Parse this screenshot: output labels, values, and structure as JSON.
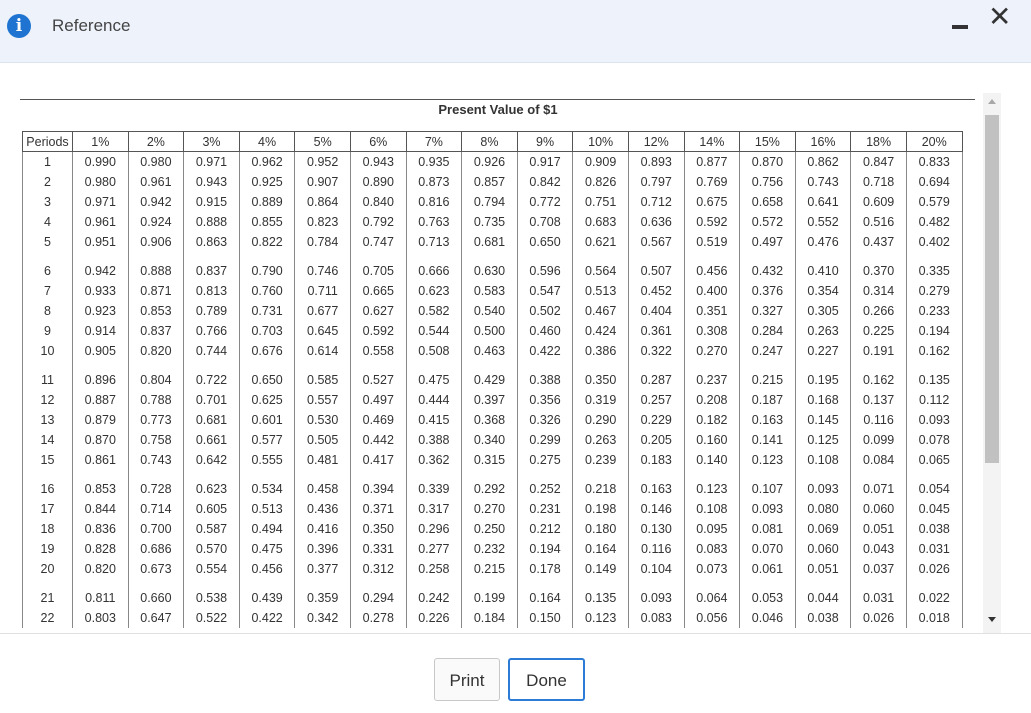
{
  "header": {
    "title": "Reference",
    "info_icon": "i",
    "minimize_icon": "minimize-icon",
    "close_icon": "✕"
  },
  "table": {
    "title": "Present Value of $1",
    "columns": [
      "Periods",
      "1%",
      "2%",
      "3%",
      "4%",
      "5%",
      "6%",
      "7%",
      "8%",
      "9%",
      "10%",
      "12%",
      "14%",
      "15%",
      "16%",
      "18%",
      "20%"
    ],
    "groups": [
      [
        [
          "1",
          "0.990",
          "0.980",
          "0.971",
          "0.962",
          "0.952",
          "0.943",
          "0.935",
          "0.926",
          "0.917",
          "0.909",
          "0.893",
          "0.877",
          "0.870",
          "0.862",
          "0.847",
          "0.833"
        ],
        [
          "2",
          "0.980",
          "0.961",
          "0.943",
          "0.925",
          "0.907",
          "0.890",
          "0.873",
          "0.857",
          "0.842",
          "0.826",
          "0.797",
          "0.769",
          "0.756",
          "0.743",
          "0.718",
          "0.694"
        ],
        [
          "3",
          "0.971",
          "0.942",
          "0.915",
          "0.889",
          "0.864",
          "0.840",
          "0.816",
          "0.794",
          "0.772",
          "0.751",
          "0.712",
          "0.675",
          "0.658",
          "0.641",
          "0.609",
          "0.579"
        ],
        [
          "4",
          "0.961",
          "0.924",
          "0.888",
          "0.855",
          "0.823",
          "0.792",
          "0.763",
          "0.735",
          "0.708",
          "0.683",
          "0.636",
          "0.592",
          "0.572",
          "0.552",
          "0.516",
          "0.482"
        ],
        [
          "5",
          "0.951",
          "0.906",
          "0.863",
          "0.822",
          "0.784",
          "0.747",
          "0.713",
          "0.681",
          "0.650",
          "0.621",
          "0.567",
          "0.519",
          "0.497",
          "0.476",
          "0.437",
          "0.402"
        ]
      ],
      [
        [
          "6",
          "0.942",
          "0.888",
          "0.837",
          "0.790",
          "0.746",
          "0.705",
          "0.666",
          "0.630",
          "0.596",
          "0.564",
          "0.507",
          "0.456",
          "0.432",
          "0.410",
          "0.370",
          "0.335"
        ],
        [
          "7",
          "0.933",
          "0.871",
          "0.813",
          "0.760",
          "0.711",
          "0.665",
          "0.623",
          "0.583",
          "0.547",
          "0.513",
          "0.452",
          "0.400",
          "0.376",
          "0.354",
          "0.314",
          "0.279"
        ],
        [
          "8",
          "0.923",
          "0.853",
          "0.789",
          "0.731",
          "0.677",
          "0.627",
          "0.582",
          "0.540",
          "0.502",
          "0.467",
          "0.404",
          "0.351",
          "0.327",
          "0.305",
          "0.266",
          "0.233"
        ],
        [
          "9",
          "0.914",
          "0.837",
          "0.766",
          "0.703",
          "0.645",
          "0.592",
          "0.544",
          "0.500",
          "0.460",
          "0.424",
          "0.361",
          "0.308",
          "0.284",
          "0.263",
          "0.225",
          "0.194"
        ],
        [
          "10",
          "0.905",
          "0.820",
          "0.744",
          "0.676",
          "0.614",
          "0.558",
          "0.508",
          "0.463",
          "0.422",
          "0.386",
          "0.322",
          "0.270",
          "0.247",
          "0.227",
          "0.191",
          "0.162"
        ]
      ],
      [
        [
          "11",
          "0.896",
          "0.804",
          "0.722",
          "0.650",
          "0.585",
          "0.527",
          "0.475",
          "0.429",
          "0.388",
          "0.350",
          "0.287",
          "0.237",
          "0.215",
          "0.195",
          "0.162",
          "0.135"
        ],
        [
          "12",
          "0.887",
          "0.788",
          "0.701",
          "0.625",
          "0.557",
          "0.497",
          "0.444",
          "0.397",
          "0.356",
          "0.319",
          "0.257",
          "0.208",
          "0.187",
          "0.168",
          "0.137",
          "0.112"
        ],
        [
          "13",
          "0.879",
          "0.773",
          "0.681",
          "0.601",
          "0.530",
          "0.469",
          "0.415",
          "0.368",
          "0.326",
          "0.290",
          "0.229",
          "0.182",
          "0.163",
          "0.145",
          "0.116",
          "0.093"
        ],
        [
          "14",
          "0.870",
          "0.758",
          "0.661",
          "0.577",
          "0.505",
          "0.442",
          "0.388",
          "0.340",
          "0.299",
          "0.263",
          "0.205",
          "0.160",
          "0.141",
          "0.125",
          "0.099",
          "0.078"
        ],
        [
          "15",
          "0.861",
          "0.743",
          "0.642",
          "0.555",
          "0.481",
          "0.417",
          "0.362",
          "0.315",
          "0.275",
          "0.239",
          "0.183",
          "0.140",
          "0.123",
          "0.108",
          "0.084",
          "0.065"
        ]
      ],
      [
        [
          "16",
          "0.853",
          "0.728",
          "0.623",
          "0.534",
          "0.458",
          "0.394",
          "0.339",
          "0.292",
          "0.252",
          "0.218",
          "0.163",
          "0.123",
          "0.107",
          "0.093",
          "0.071",
          "0.054"
        ],
        [
          "17",
          "0.844",
          "0.714",
          "0.605",
          "0.513",
          "0.436",
          "0.371",
          "0.317",
          "0.270",
          "0.231",
          "0.198",
          "0.146",
          "0.108",
          "0.093",
          "0.080",
          "0.060",
          "0.045"
        ],
        [
          "18",
          "0.836",
          "0.700",
          "0.587",
          "0.494",
          "0.416",
          "0.350",
          "0.296",
          "0.250",
          "0.212",
          "0.180",
          "0.130",
          "0.095",
          "0.081",
          "0.069",
          "0.051",
          "0.038"
        ],
        [
          "19",
          "0.828",
          "0.686",
          "0.570",
          "0.475",
          "0.396",
          "0.331",
          "0.277",
          "0.232",
          "0.194",
          "0.164",
          "0.116",
          "0.083",
          "0.070",
          "0.060",
          "0.043",
          "0.031"
        ],
        [
          "20",
          "0.820",
          "0.673",
          "0.554",
          "0.456",
          "0.377",
          "0.312",
          "0.258",
          "0.215",
          "0.178",
          "0.149",
          "0.104",
          "0.073",
          "0.061",
          "0.051",
          "0.037",
          "0.026"
        ]
      ],
      [
        [
          "21",
          "0.811",
          "0.660",
          "0.538",
          "0.439",
          "0.359",
          "0.294",
          "0.242",
          "0.199",
          "0.164",
          "0.135",
          "0.093",
          "0.064",
          "0.053",
          "0.044",
          "0.031",
          "0.022"
        ],
        [
          "22",
          "0.803",
          "0.647",
          "0.522",
          "0.422",
          "0.342",
          "0.278",
          "0.226",
          "0.184",
          "0.150",
          "0.123",
          "0.083",
          "0.056",
          "0.046",
          "0.038",
          "0.026",
          "0.018"
        ]
      ]
    ]
  },
  "buttons": {
    "print": "Print",
    "done": "Done"
  },
  "colors": {
    "header_bg": "#eef3fb",
    "info_icon": "#1e74d0",
    "done_border": "#2c7bd6"
  }
}
